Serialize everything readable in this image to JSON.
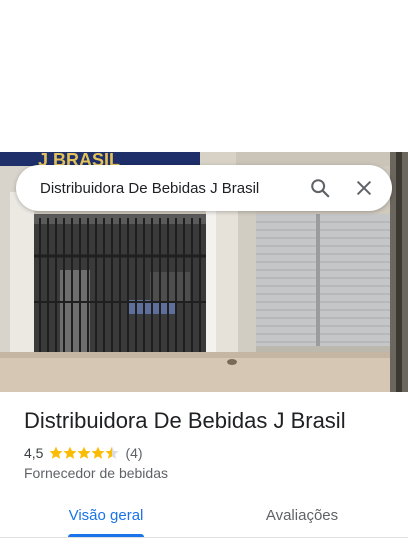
{
  "search": {
    "query": "Distribuidora De Bebidas J Brasil"
  },
  "photo": {
    "sign_text": "J BRASIL"
  },
  "place": {
    "name": "Distribuidora De Bebidas J Brasil",
    "rating": "4,5",
    "rating_stars": 4.5,
    "review_count": "(4)",
    "category": "Fornecedor de bebidas"
  },
  "tabs": [
    {
      "label": "Visão geral",
      "active": true
    },
    {
      "label": "Avaliações",
      "active": false
    }
  ],
  "colors": {
    "accent": "#1a73e8",
    "star": "#fbbc04"
  },
  "icons": [
    "search-icon",
    "close-icon",
    "star-icon"
  ]
}
